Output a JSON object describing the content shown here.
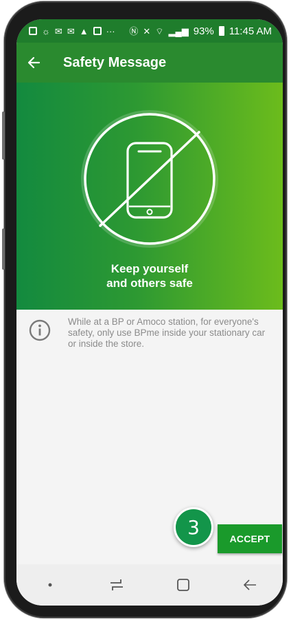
{
  "status_bar": {
    "battery": "93%",
    "time": "11:45 AM",
    "more": "···"
  },
  "app_bar": {
    "title": "Safety Message"
  },
  "hero": {
    "line1": "Keep yourself",
    "line2": "and others safe"
  },
  "info": {
    "text": "While at a BP or Amoco station, for everyone's safety, only use BPme inside your stationary car or inside the store."
  },
  "step_badge": "3",
  "accept_label": "ACCEPT",
  "colors": {
    "brand_green": "#1a9a2b",
    "hero_start": "#138a3f",
    "hero_end": "#6cbc1c"
  }
}
